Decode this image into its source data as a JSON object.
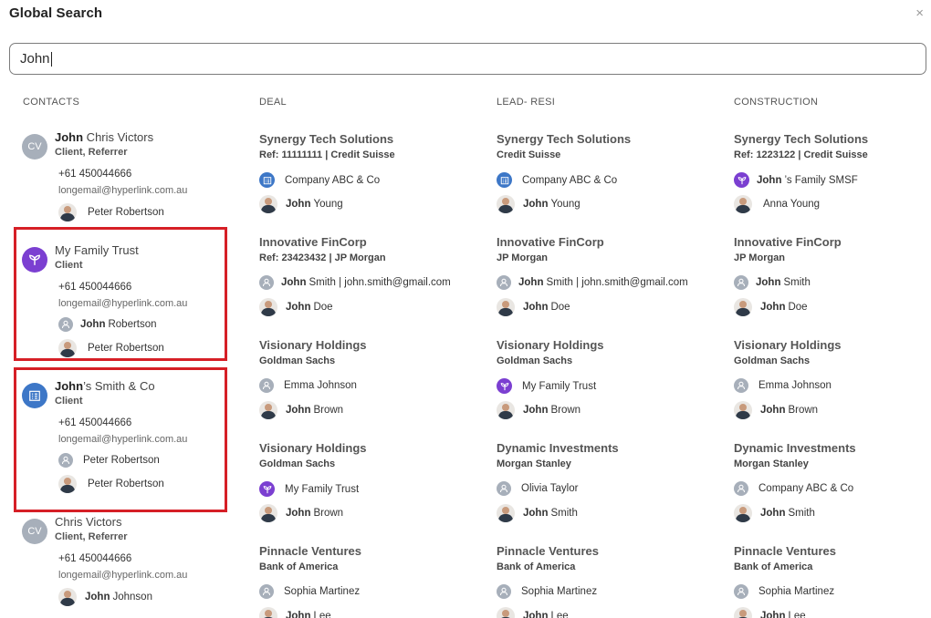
{
  "dialog": {
    "title": "Global Search",
    "close_glyph": "×"
  },
  "search": {
    "value": "John"
  },
  "columns": [
    "CONTACTS",
    "DEAL",
    "LEAD- RESI",
    "CONSTRUCTION"
  ],
  "contacts": [
    {
      "avatar": "CV",
      "avatar_type": "initials",
      "name_bold": "John",
      "name_rest": " Chris Victors",
      "roles": "Client,  Referrer",
      "phone": "+61 450044666",
      "email": "longemail@hyperlink.com.au",
      "people": [
        {
          "icon": "photo",
          "bold": "",
          "rest": "Peter Robertson"
        }
      ]
    },
    {
      "avatar": "",
      "avatar_type": "trust",
      "name_bold": "",
      "name_rest": "My Family Trust",
      "roles": "Client",
      "phone": "+61 450044666",
      "email": "longemail@hyperlink.com.au",
      "people": [
        {
          "icon": "person",
          "bold": "John",
          "rest": "Robertson"
        },
        {
          "icon": "photo",
          "bold": "",
          "rest": "Peter Robertson"
        }
      ]
    },
    {
      "avatar": "",
      "avatar_type": "company",
      "name_bold": "John",
      "name_rest": "’s Smith & Co",
      "roles": "Client",
      "phone": "+61 450044666",
      "email": "longemail@hyperlink.com.au",
      "people": [
        {
          "icon": "person",
          "bold": "",
          "rest": "Peter Robertson"
        },
        {
          "icon": "photo",
          "bold": "",
          "rest": "Peter Robertson"
        }
      ]
    },
    {
      "avatar": "CV",
      "avatar_type": "initials",
      "name_bold": "",
      "name_rest": "Chris Victors",
      "roles": "Client, Referrer",
      "phone": "+61 450044666",
      "email": "longemail@hyperlink.com.au",
      "people": [
        {
          "icon": "photo",
          "bold": "John",
          "rest": "Johnson"
        }
      ]
    }
  ],
  "deal": [
    {
      "title": "Synergy Tech Solutions",
      "ref": "Ref: 11111111 | Credit Suisse",
      "line1": {
        "icon": "company",
        "bold": "",
        "rest": "Company ABC & Co"
      },
      "line2": {
        "icon": "photo",
        "bold": "John",
        "rest": "Young"
      }
    },
    {
      "title": "Innovative FinCorp",
      "ref": "Ref: 23423432 | JP Morgan",
      "line1": {
        "icon": "person",
        "bold": "John",
        "rest": "Smith | john.smith@gmail.com"
      },
      "line2": {
        "icon": "photo",
        "bold": "John",
        "rest": "Doe"
      }
    },
    {
      "title": "Visionary Holdings",
      "ref": "Goldman Sachs",
      "line1": {
        "icon": "person",
        "bold": "",
        "rest": "Emma Johnson"
      },
      "line2": {
        "icon": "photo",
        "bold": "John",
        "rest": "Brown"
      }
    },
    {
      "title": "Visionary Holdings",
      "ref": "Goldman Sachs",
      "line1": {
        "icon": "trust",
        "bold": "",
        "rest": "My Family Trust"
      },
      "line2": {
        "icon": "photo",
        "bold": "John",
        "rest": "Brown"
      }
    },
    {
      "title": "Pinnacle Ventures",
      "ref": "Bank of America",
      "line1": {
        "icon": "person",
        "bold": "",
        "rest": "Sophia Martinez"
      },
      "line2": {
        "icon": "photo",
        "bold": "John",
        "rest": "Lee"
      }
    }
  ],
  "lead_resi": [
    {
      "title": "Synergy Tech Solutions",
      "ref": "Credit Suisse",
      "line1": {
        "icon": "company",
        "bold": "",
        "rest": "Company ABC & Co"
      },
      "line2": {
        "icon": "photo",
        "bold": "John",
        "rest": "Young"
      }
    },
    {
      "title": "Innovative FinCorp",
      "ref": "JP Morgan",
      "line1": {
        "icon": "person",
        "bold": "John",
        "rest": "Smith | john.smith@gmail.com"
      },
      "line2": {
        "icon": "photo",
        "bold": "John",
        "rest": "Doe"
      }
    },
    {
      "title": "Visionary Holdings",
      "ref": "Goldman Sachs",
      "line1": {
        "icon": "trust",
        "bold": "",
        "rest": "My Family Trust"
      },
      "line2": {
        "icon": "photo",
        "bold": "John",
        "rest": "Brown"
      }
    },
    {
      "title": "Dynamic Investments",
      "ref": "Morgan Stanley",
      "line1": {
        "icon": "person",
        "bold": "",
        "rest": "Olivia Taylor"
      },
      "line2": {
        "icon": "photo",
        "bold": "John",
        "rest": "Smith"
      }
    },
    {
      "title": "Pinnacle Ventures",
      "ref": "Bank of America",
      "line1": {
        "icon": "person",
        "bold": "",
        "rest": "Sophia Martinez"
      },
      "line2": {
        "icon": "photo",
        "bold": "John",
        "rest": "Lee"
      }
    }
  ],
  "construction": [
    {
      "title": "Synergy Tech Solutions",
      "ref": "Ref: 1223122 | Credit Suisse",
      "line1": {
        "icon": "trust",
        "bold": "John",
        "rest": "’s Family SMSF"
      },
      "line2": {
        "icon": "photo",
        "bold": "",
        "rest": "Anna Young"
      }
    },
    {
      "title": "Innovative FinCorp",
      "ref": "JP Morgan",
      "line1": {
        "icon": "person",
        "bold": "John",
        "rest": "Smith"
      },
      "line2": {
        "icon": "photo",
        "bold": "John",
        "rest": "Doe"
      }
    },
    {
      "title": "Visionary Holdings",
      "ref": "Goldman Sachs",
      "line1": {
        "icon": "person",
        "bold": "",
        "rest": "Emma Johnson"
      },
      "line2": {
        "icon": "photo",
        "bold": "John",
        "rest": "Brown"
      }
    },
    {
      "title": "Dynamic Investments",
      "ref": "Morgan Stanley",
      "line1": {
        "icon": "person",
        "bold": "",
        "rest": "Company ABC & Co"
      },
      "line2": {
        "icon": "photo",
        "bold": "John",
        "rest": "Smith"
      }
    },
    {
      "title": "Pinnacle Ventures",
      "ref": "Bank of America",
      "line1": {
        "icon": "person",
        "bold": "",
        "rest": "Sophia Martinez"
      },
      "line2": {
        "icon": "photo",
        "bold": "John",
        "rest": "Lee"
      }
    }
  ],
  "colors": {
    "highlight": "#d61f26",
    "trust": "#7b3fd1",
    "company": "#3d77c7",
    "avatar_grey": "#a7afba"
  }
}
